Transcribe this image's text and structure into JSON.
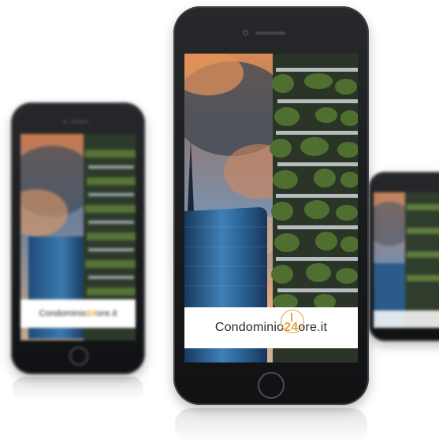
{
  "brand": {
    "name_part1": "Condominio",
    "name_accent": "24",
    "name_part2": "ore.it"
  },
  "colors": {
    "accent": "#e6a23c",
    "phone_body": "#1a1b1d",
    "sky_warm": "#e08a50",
    "sky_cool": "#5f7fa3",
    "glass_tower": "#2c5d8a",
    "greenery": "#3f5a2c"
  },
  "icons": {
    "logo_mark": "clock-icon"
  }
}
